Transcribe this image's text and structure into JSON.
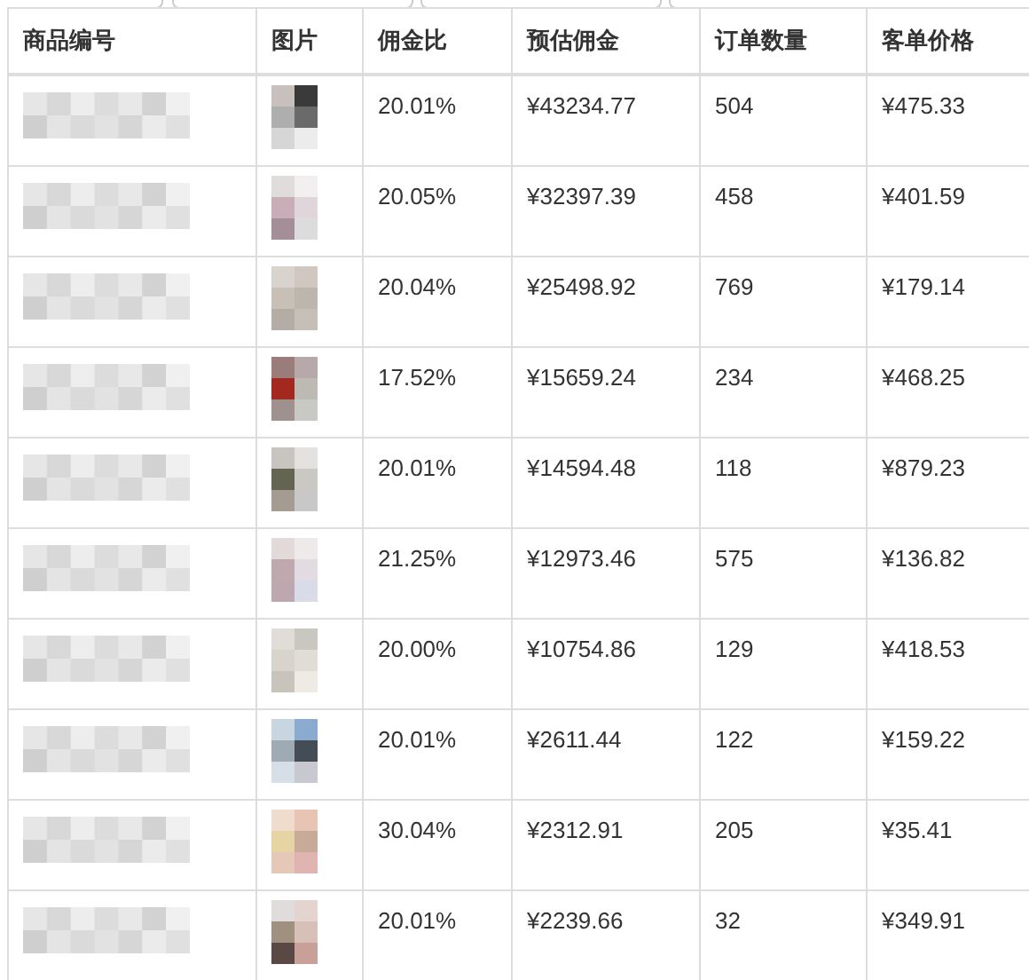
{
  "table": {
    "columns": [
      "商品编号",
      "图片",
      "佣金比",
      "预估佣金",
      "订单数量",
      "客单价格"
    ],
    "rows": [
      {
        "commission_rate": "20.01%",
        "estimated_commission": "¥43234.77",
        "orders": "504",
        "unit_price": "¥475.33"
      },
      {
        "commission_rate": "20.05%",
        "estimated_commission": "¥32397.39",
        "orders": "458",
        "unit_price": "¥401.59"
      },
      {
        "commission_rate": "20.04%",
        "estimated_commission": "¥25498.92",
        "orders": "769",
        "unit_price": "¥179.14"
      },
      {
        "commission_rate": "17.52%",
        "estimated_commission": "¥15659.24",
        "orders": "234",
        "unit_price": "¥468.25"
      },
      {
        "commission_rate": "20.01%",
        "estimated_commission": "¥14594.48",
        "orders": "118",
        "unit_price": "¥879.23"
      },
      {
        "commission_rate": "21.25%",
        "estimated_commission": "¥12973.46",
        "orders": "575",
        "unit_price": "¥136.82"
      },
      {
        "commission_rate": "20.00%",
        "estimated_commission": "¥10754.86",
        "orders": "129",
        "unit_price": "¥418.53"
      },
      {
        "commission_rate": "20.01%",
        "estimated_commission": "¥2611.44",
        "orders": "122",
        "unit_price": "¥159.22"
      },
      {
        "commission_rate": "30.04%",
        "estimated_commission": "¥2312.91",
        "orders": "205",
        "unit_price": "¥35.41"
      },
      {
        "commission_rate": "20.01%",
        "estimated_commission": "¥2239.66",
        "orders": "32",
        "unit_price": "¥349.91"
      }
    ]
  }
}
